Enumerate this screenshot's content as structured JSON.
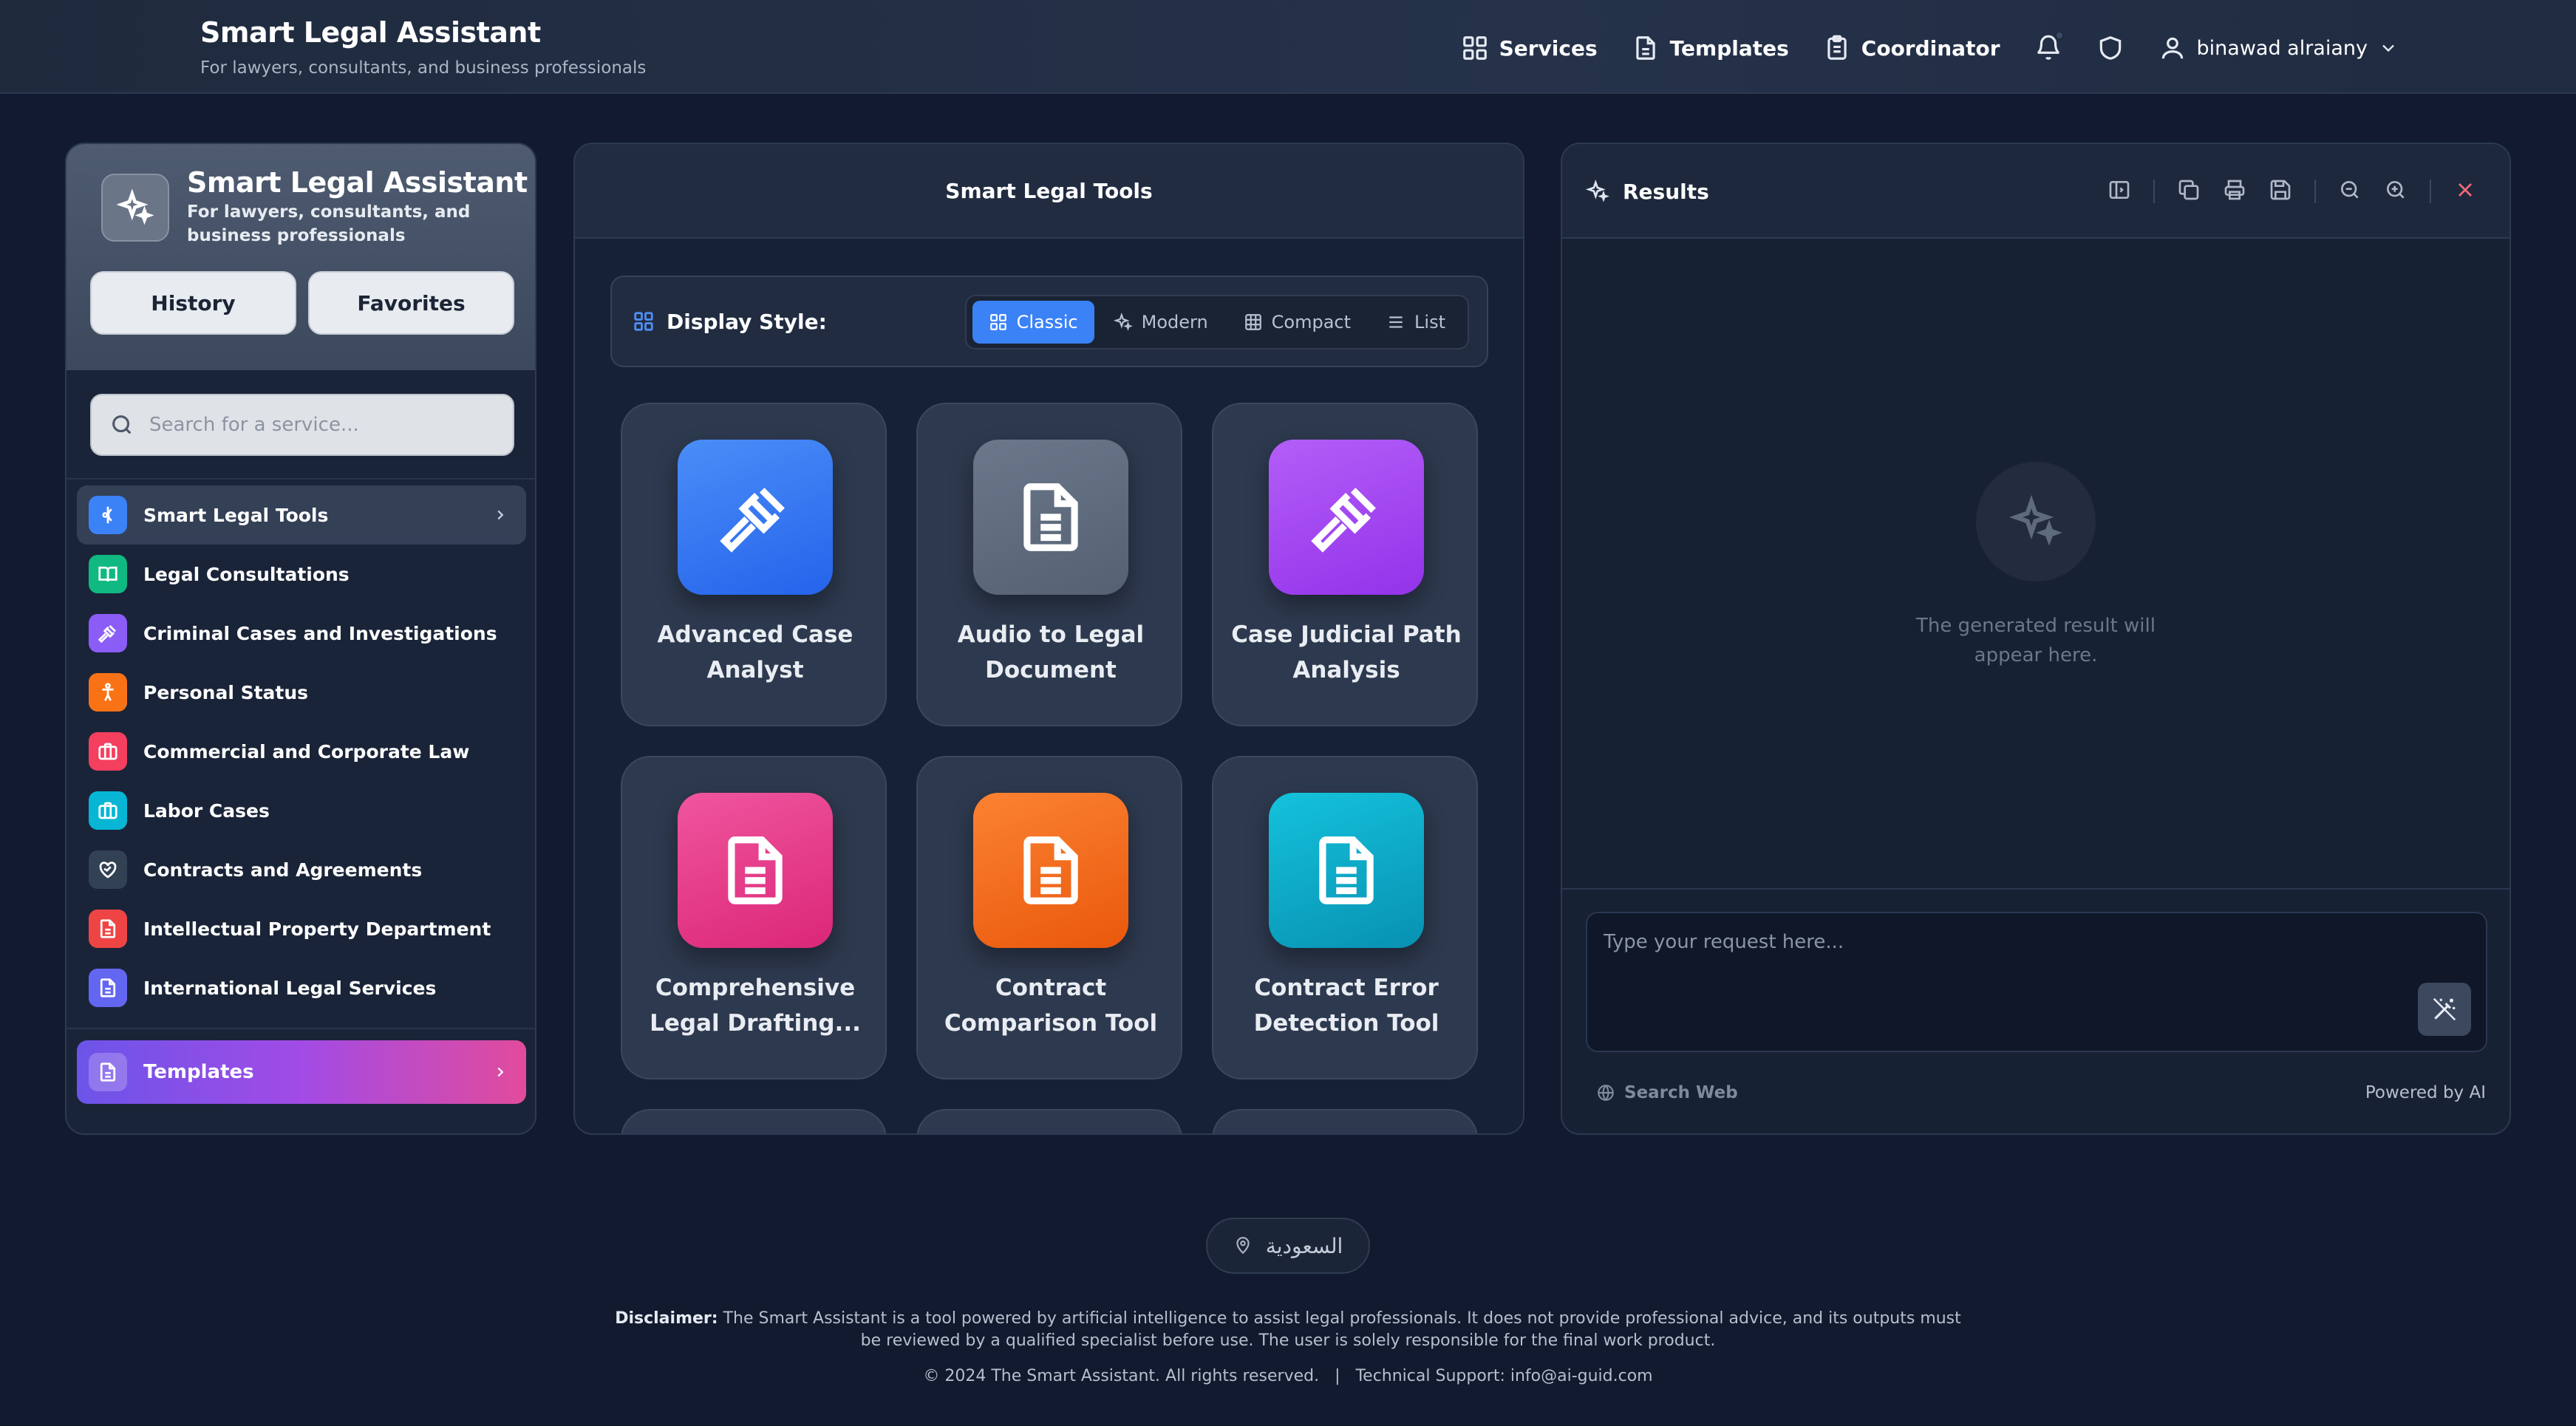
{
  "header": {
    "title": "Smart Legal Assistant",
    "subtitle": "For lawyers, consultants, and business professionals",
    "nav": [
      {
        "label": "Services",
        "icon": "grid-icon"
      },
      {
        "label": "Templates",
        "icon": "document-icon"
      },
      {
        "label": "Coordinator",
        "icon": "clipboard-icon"
      }
    ],
    "user": "binawad alraiany"
  },
  "sidebar": {
    "title": "Smart Legal Assistant",
    "subtitle": "For lawyers, consultants, and business professionals",
    "history_label": "History",
    "favorites_label": "Favorites",
    "search_placeholder": "Search for a service...",
    "items": [
      {
        "label": "Smart Legal Tools",
        "color": "#3b82f6",
        "active": true
      },
      {
        "label": "Legal Consultations",
        "color": "#10b981"
      },
      {
        "label": "Criminal Cases and Investigations",
        "color": "#8b5cf6"
      },
      {
        "label": "Personal Status",
        "color": "#f97316"
      },
      {
        "label": "Commercial and Corporate Law",
        "color": "#f43f5e"
      },
      {
        "label": "Labor Cases",
        "color": "#06b6d4"
      },
      {
        "label": "Contracts and Agreements",
        "color": "#334155"
      },
      {
        "label": "Intellectual Property Department",
        "color": "#ef4444"
      },
      {
        "label": "International Legal Services",
        "color": "#6366f1"
      }
    ],
    "templates_label": "Templates"
  },
  "tools": {
    "title": "Smart Legal Tools",
    "display_style_label": "Display Style:",
    "styles": [
      "Classic",
      "Modern",
      "Compact",
      "List"
    ],
    "active_style": "Classic",
    "cards": [
      {
        "name": "Advanced Case Analyst",
        "icon": "gavel-icon",
        "color": "#3b82f6"
      },
      {
        "name": "Audio to Legal Document",
        "icon": "document-icon",
        "color": "#64748b"
      },
      {
        "name": "Case Judicial Path Analysis",
        "icon": "gavel-icon",
        "color": "#a855f7"
      },
      {
        "name": "Comprehensive Legal Drafting...",
        "icon": "document-icon",
        "color": "#ec4899"
      },
      {
        "name": "Contract Comparison Tool",
        "icon": "document-icon",
        "color": "#f97316"
      },
      {
        "name": "Contract Error Detection Tool",
        "icon": "document-icon",
        "color": "#06b6d4"
      }
    ]
  },
  "results": {
    "title": "Results",
    "empty_text": "The generated result will appear here.",
    "input_placeholder": "Type your request here...",
    "search_web_label": "Search Web",
    "powered_label": "Powered by AI"
  },
  "footer": {
    "location": "السعودية",
    "disclaimer_label": "Disclaimer:",
    "disclaimer_text": "The Smart Assistant is a tool powered by artificial intelligence to assist legal professionals. It does not provide professional advice, and its outputs must be reviewed by a qualified specialist before use. The user is solely responsible for the final work product.",
    "copyright": "© 2024 The Smart Assistant. All rights reserved.   |   Technical Support: info@ai-guid.com"
  }
}
